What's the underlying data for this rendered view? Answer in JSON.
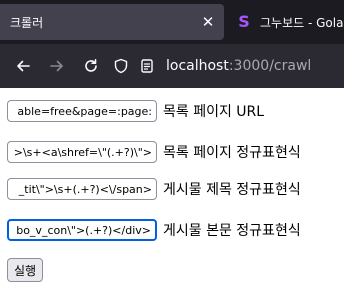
{
  "browser": {
    "tabs": [
      {
        "title": "크롤러",
        "close_glyph": "✕",
        "active": true
      },
      {
        "title": "그누보드 - Golang",
        "favicon_glyph": "S",
        "active": false
      }
    ],
    "url": {
      "host": "localhost",
      "rest": ":3000/crawl"
    }
  },
  "form": {
    "fields": [
      {
        "value": "able=free&page=:page:",
        "label": "목록 페이지 URL"
      },
      {
        "value": ">\\s+<a\\shref=\\\"(.+?)\\\">",
        "label": "목록 페이지 정규표현식"
      },
      {
        "value": "_tit\\\">\\s+(.+?)<\\/span>",
        "label": "게시물 제목 정규표현식"
      },
      {
        "value": "bo_v_con\\\">(.+?)</div>",
        "label": "게시물 본문 정규표현식"
      }
    ],
    "run_label": "실행"
  }
}
